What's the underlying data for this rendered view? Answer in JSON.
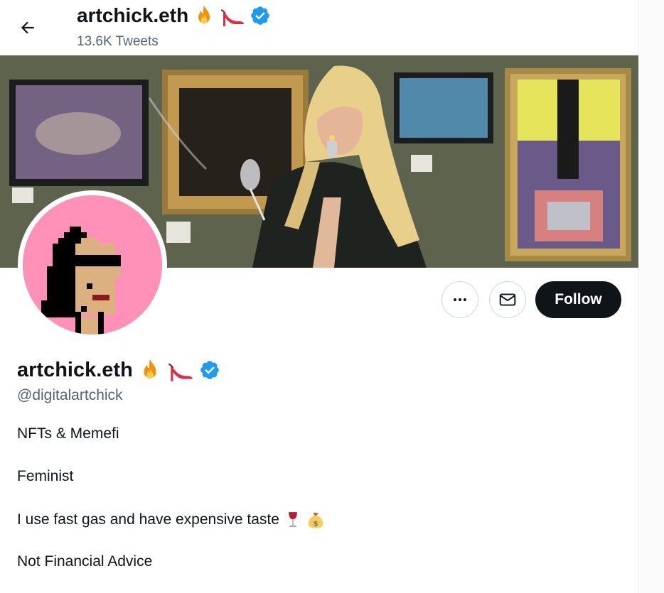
{
  "header": {
    "display_name": "artchick.eth",
    "tweet_count": "13.6K Tweets"
  },
  "profile": {
    "display_name": "artchick.eth",
    "handle": "@digitalartchick",
    "bio_lines": [
      "NFTs & Memefi",
      "Feminist",
      "I use fast gas and have expensive taste",
      "Not Financial Advice"
    ],
    "name_emojis": [
      "fire-emoji",
      "high-heel-emoji"
    ],
    "bio_emojis": [
      "wine-glass-emoji",
      "money-bag-emoji"
    ]
  },
  "actions": {
    "follow_label": "Follow"
  },
  "colors": {
    "text": "#0f1419",
    "muted": "#536471",
    "verified": "#1d9bf0",
    "follow_bg": "#0f1419",
    "avatar_bg": "#ff90b8"
  },
  "icons": [
    "back-arrow-icon",
    "more-icon",
    "mail-icon",
    "verified-badge-icon"
  ]
}
